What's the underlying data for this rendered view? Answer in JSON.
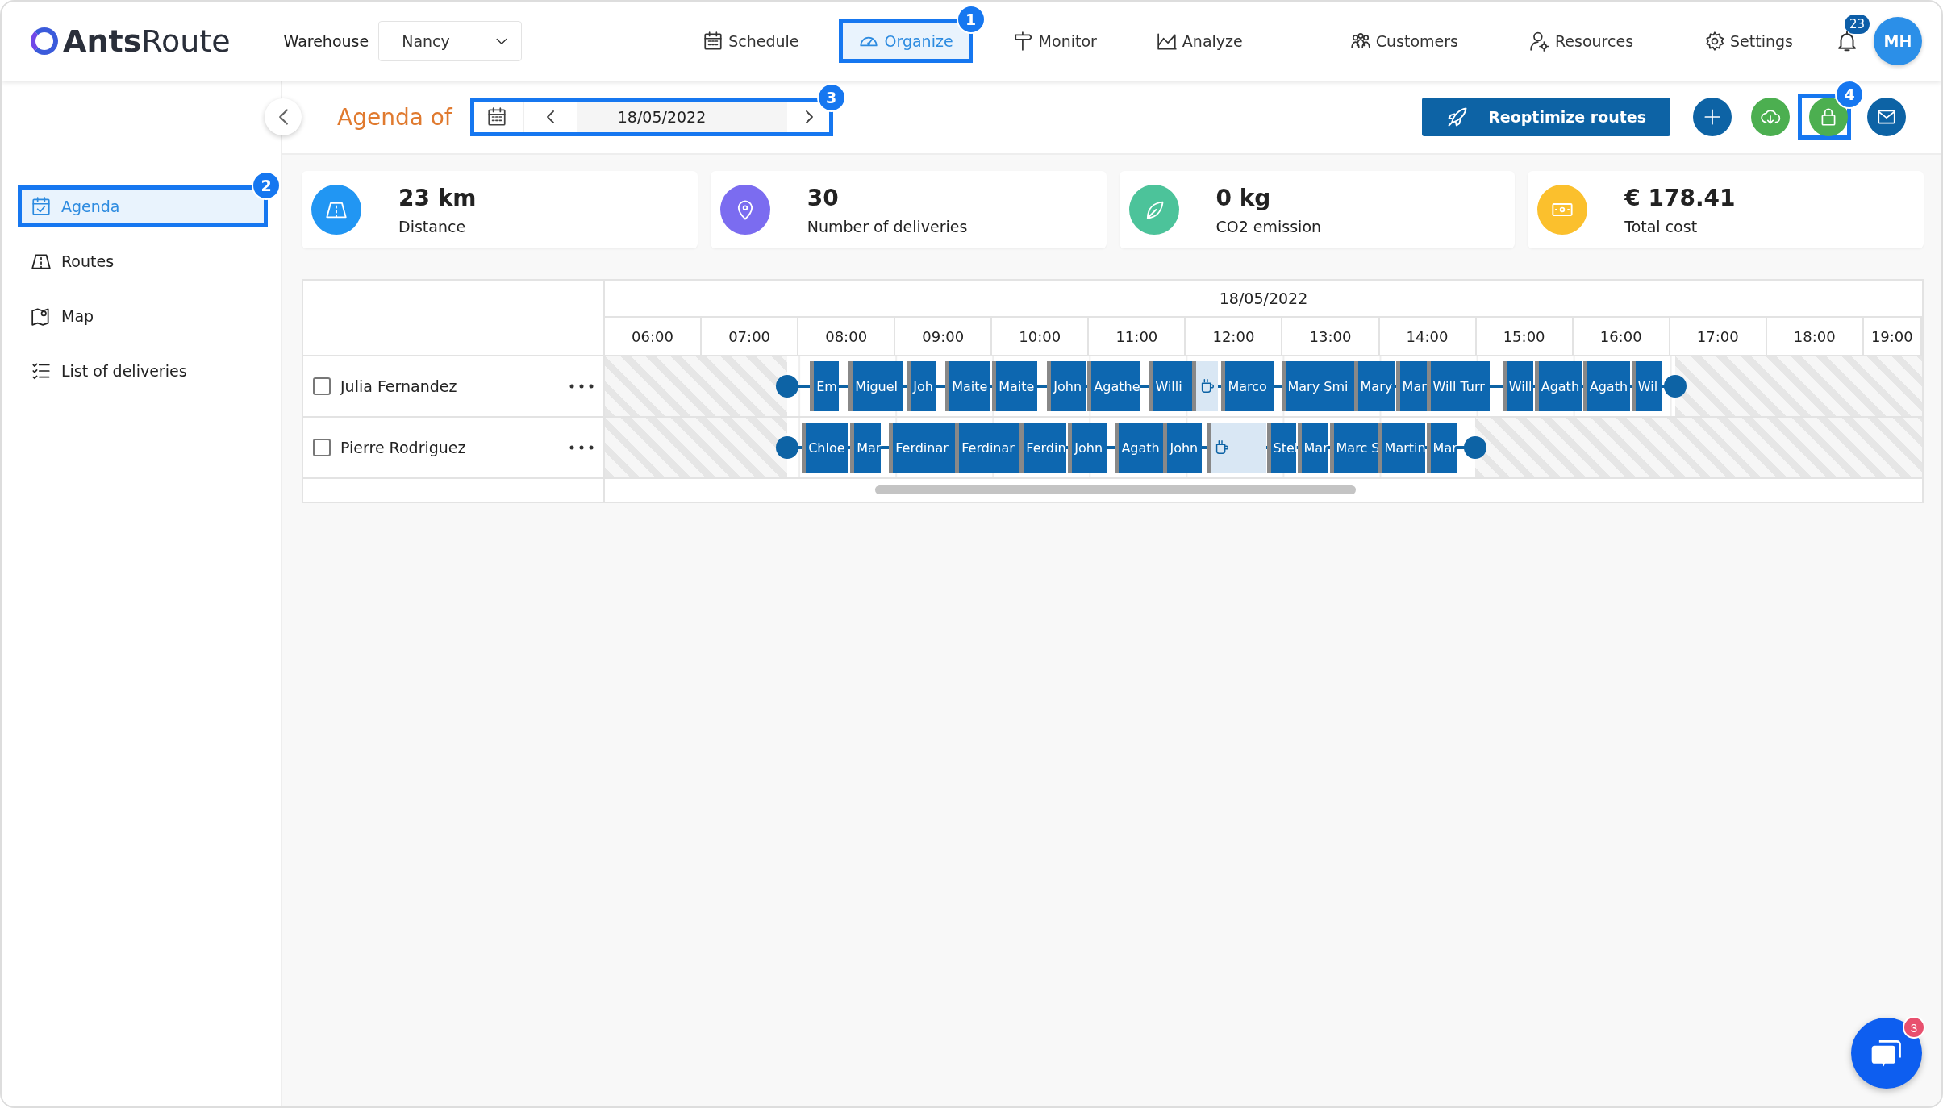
{
  "header": {
    "logo": {
      "bold": "Ants",
      "light": "Route"
    },
    "warehouse": {
      "label": "Warehouse",
      "value": "Nancy"
    },
    "nav": [
      {
        "label": "Schedule",
        "selected": false
      },
      {
        "label": "Organize",
        "selected": true,
        "callout": "1"
      },
      {
        "label": "Monitor",
        "selected": false
      },
      {
        "label": "Analyze",
        "selected": false
      }
    ],
    "right_nav": [
      {
        "label": "Customers"
      },
      {
        "label": "Resources"
      },
      {
        "label": "Settings"
      }
    ],
    "notifications": "23",
    "avatar": "MH"
  },
  "sidebar": {
    "items": [
      {
        "label": "Agenda",
        "selected": true,
        "callout": "2"
      },
      {
        "label": "Routes",
        "selected": false
      },
      {
        "label": "Map",
        "selected": false
      },
      {
        "label": "List of deliveries",
        "selected": false
      }
    ]
  },
  "toolbar": {
    "title": "Agenda of",
    "date": "18/05/2022",
    "date_callout": "3",
    "reoptimize": "Reoptimize routes",
    "actions": [
      {
        "color": "#0d63a5"
      },
      {
        "color": "#4caf50"
      },
      {
        "color": "#4caf50",
        "callout": "4"
      },
      {
        "color": "#0d63a5"
      }
    ]
  },
  "stats": [
    {
      "value": "23 km",
      "label": "Distance",
      "color": "#2196f3"
    },
    {
      "value": "30",
      "label": "Number of deliveries",
      "color": "#7b6cf0"
    },
    {
      "value": "0 kg",
      "label": "CO2 emission",
      "color": "#4cc39a"
    },
    {
      "value": "€ 178.41",
      "label": "Total cost",
      "color": "#fbc02d"
    }
  ],
  "agenda": {
    "date": "18/05/2022",
    "hours": [
      "06:00",
      "07:00",
      "08:00",
      "09:00",
      "10:00",
      "11:00",
      "12:00",
      "13:00",
      "14:00",
      "15:00",
      "16:00",
      "17:00",
      "18:00",
      "19:00"
    ],
    "resources": [
      {
        "name": "Julia Fernandez",
        "checked": false,
        "stops": [
          {
            "kind": "delivery",
            "label": "Em"
          },
          {
            "kind": "delivery",
            "label": "Miguel"
          },
          {
            "kind": "delivery",
            "label": "Joh"
          },
          {
            "kind": "delivery",
            "label": "Maite"
          },
          {
            "kind": "delivery",
            "label": "Maite"
          },
          {
            "kind": "delivery",
            "label": "John"
          },
          {
            "kind": "delivery",
            "label": "Agathe"
          },
          {
            "kind": "delivery",
            "label": "Willi"
          },
          {
            "kind": "break"
          },
          {
            "kind": "delivery",
            "label": "Marco"
          },
          {
            "kind": "delivery",
            "label": "Mary Smi"
          },
          {
            "kind": "delivery",
            "label": "Mary"
          },
          {
            "kind": "delivery",
            "label": "Mar"
          },
          {
            "kind": "delivery",
            "label": "Will Turr"
          },
          {
            "kind": "delivery",
            "label": "Will"
          },
          {
            "kind": "delivery",
            "label": "Agath"
          },
          {
            "kind": "delivery",
            "label": "Agath"
          },
          {
            "kind": "delivery",
            "label": "Wil"
          }
        ]
      },
      {
        "name": "Pierre Rodriguez",
        "checked": false,
        "stops": [
          {
            "kind": "delivery",
            "label": "Chloe"
          },
          {
            "kind": "delivery",
            "label": "Mar"
          },
          {
            "kind": "delivery",
            "label": "Ferdinar"
          },
          {
            "kind": "delivery",
            "label": "Ferdinar"
          },
          {
            "kind": "delivery",
            "label": "Ferdin"
          },
          {
            "kind": "delivery",
            "label": "John"
          },
          {
            "kind": "delivery",
            "label": "Agath"
          },
          {
            "kind": "delivery",
            "label": "John"
          },
          {
            "kind": "break"
          },
          {
            "kind": "delivery",
            "label": "Stel"
          },
          {
            "kind": "delivery",
            "label": "Mar"
          },
          {
            "kind": "delivery",
            "label": "Marc S"
          },
          {
            "kind": "delivery",
            "label": "Martin"
          },
          {
            "kind": "delivery",
            "label": "Mar"
          }
        ]
      }
    ]
  },
  "chat": {
    "badge": "3"
  }
}
